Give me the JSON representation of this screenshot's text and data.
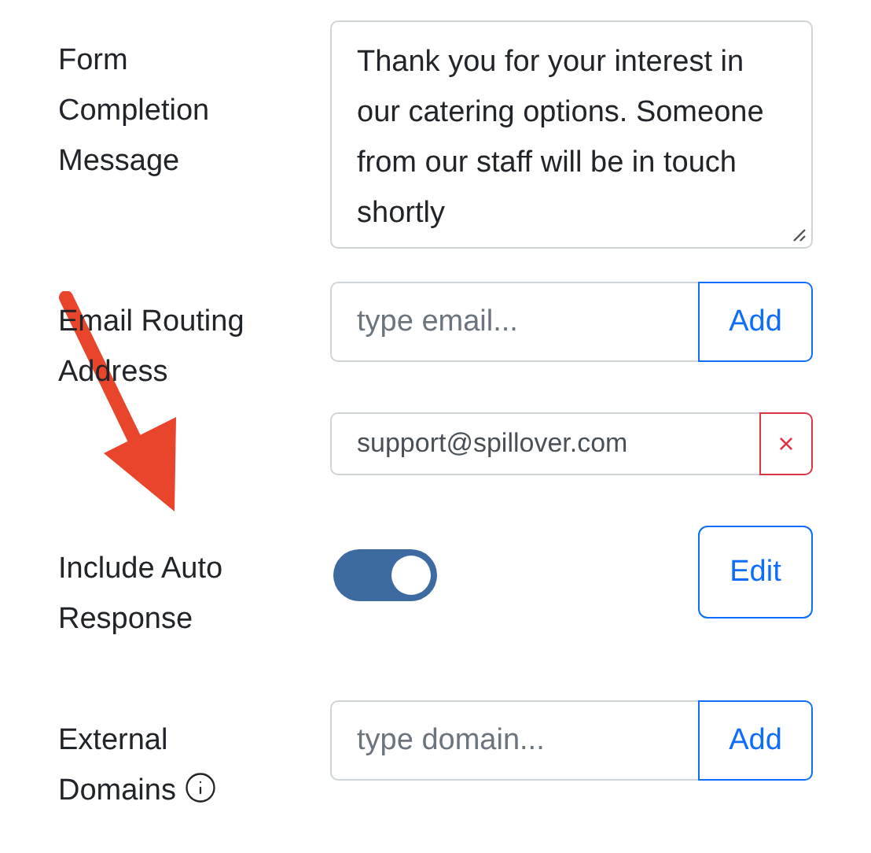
{
  "fields": [
    {
      "kind": "textarea",
      "label": "Form Completion Message",
      "value": "Thank you for your interest in our catering options. Someone from our staff will be in touch shortly"
    },
    {
      "kind": "input_add",
      "label": "Email Routing Address",
      "placeholder": "type email...",
      "button": "Add",
      "entries": [
        {
          "value": "support@spillover.com",
          "remove": "×"
        }
      ]
    },
    {
      "kind": "toggle",
      "label": "Include Auto Response",
      "on": true,
      "button": "Edit"
    },
    {
      "kind": "input_add",
      "label": "External Domains",
      "info": true,
      "placeholder": "type domain...",
      "button": "Add"
    }
  ],
  "annotation": {
    "kind": "arrow",
    "color": "#e8452c"
  }
}
